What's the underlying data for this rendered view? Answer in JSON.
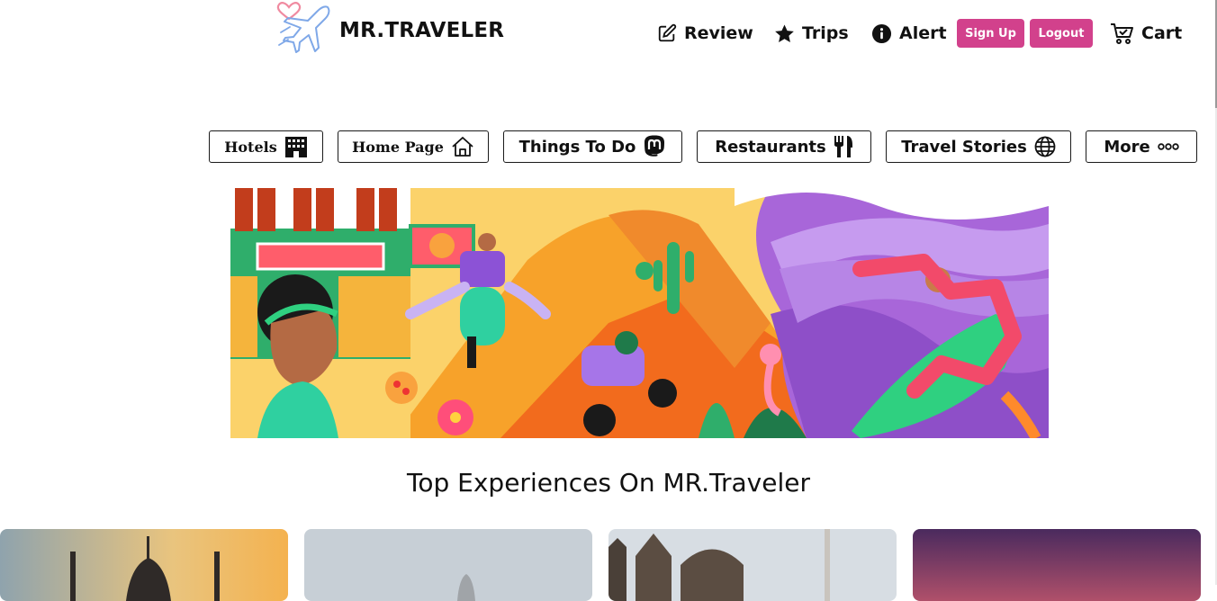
{
  "brand": {
    "name": "MR.TRAVELER",
    "logo_icon": "plane-heart-icon"
  },
  "nav": {
    "review": {
      "label": "Review",
      "icon": "edit-icon"
    },
    "trips": {
      "label": "Trips",
      "icon": "star-icon"
    },
    "alert": {
      "label": "Alert",
      "icon": "info-icon"
    },
    "signup": {
      "label": "Sign Up"
    },
    "logout": {
      "label": "Logout"
    },
    "cart": {
      "label": "Cart",
      "icon": "cart-icon"
    }
  },
  "categories": [
    {
      "label": "Hotels",
      "icon": "building-icon"
    },
    {
      "label": "Home Page",
      "icon": "home-icon"
    },
    {
      "label": "Things To Do",
      "icon": "mastodon-icon"
    },
    {
      "label": "Restaurants",
      "icon": "utensils-icon"
    },
    {
      "label": "Travel Stories",
      "icon": "globe-icon"
    },
    {
      "label": "More",
      "icon": "ellipsis-icon"
    }
  ],
  "section": {
    "title": "Top Experiences On MR.Traveler"
  },
  "colors": {
    "accent": "#d2418c",
    "text": "#111111",
    "logo_blue": "#7fa8e8",
    "logo_pink": "#f08aa0"
  }
}
